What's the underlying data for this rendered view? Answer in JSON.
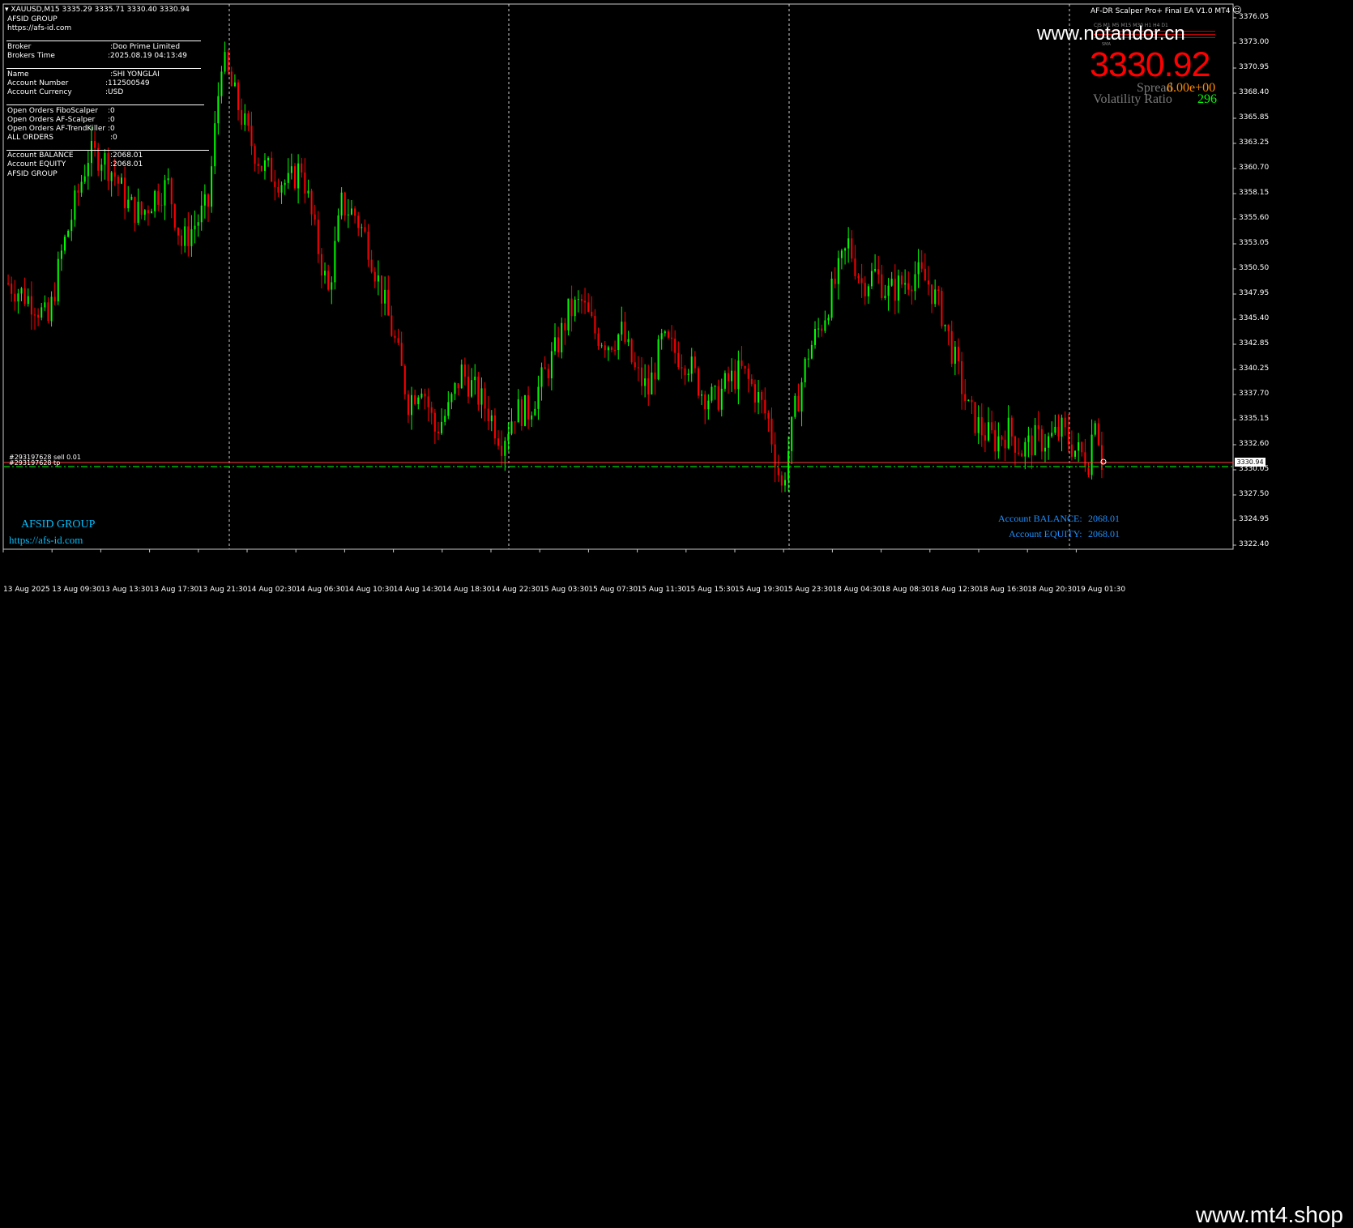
{
  "header": {
    "symbol": "XAUUSD,M15",
    "ohlc": "3335.29 3335.71 3330.40 3330.94",
    "ea_title": "AF-DR Scalper Pro+ Final EA V1.0 MT4",
    "smiley": "☺"
  },
  "info_panel": {
    "company": "AFSID GROUP",
    "site": "https://afs-id.com",
    "broker_label": "Broker",
    "broker_value": ":Doo Prime Limited",
    "time_label": "Brokers Time",
    "time_value": ":2025.08.19 04:13:49",
    "name_label": "Name",
    "name_value": ":SHI YONGLAI",
    "acct_num_label": "Account Number",
    "acct_num_value": ":112500549",
    "acct_cur_label": "Account Currency",
    "acct_cur_value": ":USD",
    "oo_fibo_label": "Open Orders FiboScalper",
    "oo_fibo_value": ":0",
    "oo_afs_label": "Open Orders AF-Scalper",
    "oo_afs_value": ":0",
    "oo_aft_label": "Open Orders AF-TrendKiller",
    "oo_aft_value": ":0",
    "all_orders_label": "ALL ORDERS",
    "all_orders_value": ":0",
    "bal_label": "Account BALANCE",
    "bal_value": ":2068.01",
    "eq_label": "Account EQUITY",
    "eq_value": ":2068.01",
    "group_label": "AFSID GROUP"
  },
  "ea_panel": {
    "watermark": "www.notandor.cn",
    "timeframes": "CJS M1 M5 M15 M30 H1 H4 D1",
    "sma_label": "SMA",
    "price": "3330.92",
    "spread_label": "Spread",
    "spread_value": "6.00e+00",
    "vol_label": "Volatility Ratio",
    "vol_value": "296"
  },
  "order_labels": {
    "sell": "#293197628 sell 0.01",
    "tp": "#293197628 tp"
  },
  "bottom_left": {
    "group": "AFSID GROUP",
    "site": "https://afs-id.com"
  },
  "bottom_right": {
    "balance_label": "Account BALANCE:",
    "balance_value": "2068.01",
    "equity_label": "Account EQUITY:",
    "equity_value": "2068.01"
  },
  "price_axis": {
    "labels": [
      "3376.05",
      "3373.00",
      "3370.95",
      "3368.40",
      "3365.85",
      "3363.25",
      "3360.70",
      "3358.15",
      "3355.60",
      "3353.05",
      "3350.50",
      "3347.95",
      "3345.40",
      "3342.85",
      "3340.25",
      "3337.70",
      "3335.15",
      "3332.60",
      "3330.05",
      "3327.50",
      "3324.95",
      "3322.40"
    ],
    "current": "3330.94",
    "colors": {
      "bull": "#00ff00",
      "bear": "#ff0000",
      "grid": "#c8c8c8",
      "tp_line": "#00b400"
    }
  },
  "time_axis": {
    "labels": [
      "13 Aug 2025",
      "13 Aug 09:30",
      "13 Aug 13:30",
      "13 Aug 17:30",
      "13 Aug 21:30",
      "14 Aug 02:30",
      "14 Aug 06:30",
      "14 Aug 10:30",
      "14 Aug 14:30",
      "14 Aug 18:30",
      "14 Aug 22:30",
      "15 Aug 03:30",
      "15 Aug 07:30",
      "15 Aug 11:30",
      "15 Aug 15:30",
      "15 Aug 19:30",
      "15 Aug 23:30",
      "18 Aug 04:30",
      "18 Aug 08:30",
      "18 Aug 12:30",
      "18 Aug 16:30",
      "18 Aug 20:30",
      "19 Aug 01:30"
    ]
  },
  "chart_data": {
    "type": "candlestick",
    "symbol": "XAUUSD",
    "timeframe": "M15",
    "ylim": [
      3322.4,
      3376.05
    ],
    "anchors": [
      [
        0,
        3349
      ],
      [
        8,
        3347
      ],
      [
        12,
        3345
      ],
      [
        16,
        3352
      ],
      [
        20,
        3357
      ],
      [
        24,
        3362
      ],
      [
        28,
        3362
      ],
      [
        32,
        3360
      ],
      [
        36,
        3357
      ],
      [
        40,
        3356
      ],
      [
        44,
        3358
      ],
      [
        48,
        3359
      ],
      [
        52,
        3353
      ],
      [
        56,
        3355
      ],
      [
        60,
        3357
      ],
      [
        64,
        3372
      ],
      [
        68,
        3368
      ],
      [
        72,
        3364
      ],
      [
        76,
        3361
      ],
      [
        80,
        3360
      ],
      [
        84,
        3359
      ],
      [
        88,
        3361
      ],
      [
        92,
        3354
      ],
      [
        96,
        3348
      ],
      [
        100,
        3357
      ],
      [
        104,
        3356
      ],
      [
        108,
        3353
      ],
      [
        112,
        3348
      ],
      [
        116,
        3343
      ],
      [
        120,
        3337
      ],
      [
        124,
        3339
      ],
      [
        128,
        3334
      ],
      [
        132,
        3336
      ],
      [
        136,
        3340
      ],
      [
        140,
        3338
      ],
      [
        144,
        3336
      ],
      [
        148,
        3333
      ],
      [
        152,
        3336
      ],
      [
        156,
        3336
      ],
      [
        160,
        3339
      ],
      [
        164,
        3342
      ],
      [
        168,
        3346
      ],
      [
        172,
        3347
      ],
      [
        176,
        3344
      ],
      [
        180,
        3343
      ],
      [
        184,
        3344
      ],
      [
        188,
        3340
      ],
      [
        192,
        3338
      ],
      [
        196,
        3343
      ],
      [
        200,
        3342
      ],
      [
        204,
        3341
      ],
      [
        208,
        3338
      ],
      [
        212,
        3337
      ],
      [
        216,
        3339
      ],
      [
        220,
        3340
      ],
      [
        224,
        3338
      ],
      [
        228,
        3335
      ],
      [
        232,
        3328
      ],
      [
        236,
        3336
      ],
      [
        240,
        3342
      ],
      [
        244,
        3345
      ],
      [
        248,
        3349
      ],
      [
        252,
        3353
      ],
      [
        256,
        3349
      ],
      [
        260,
        3350
      ],
      [
        264,
        3348
      ],
      [
        268,
        3349
      ],
      [
        272,
        3350
      ],
      [
        276,
        3349
      ],
      [
        280,
        3346
      ],
      [
        284,
        3341
      ],
      [
        288,
        3336
      ],
      [
        292,
        3334
      ],
      [
        296,
        3333
      ],
      [
        300,
        3334
      ],
      [
        304,
        3332
      ],
      [
        308,
        3333
      ],
      [
        312,
        3333
      ],
      [
        316,
        3334
      ],
      [
        320,
        3332
      ],
      [
        324,
        3331
      ],
      [
        326,
        3336
      ],
      [
        328,
        3331
      ]
    ]
  }
}
